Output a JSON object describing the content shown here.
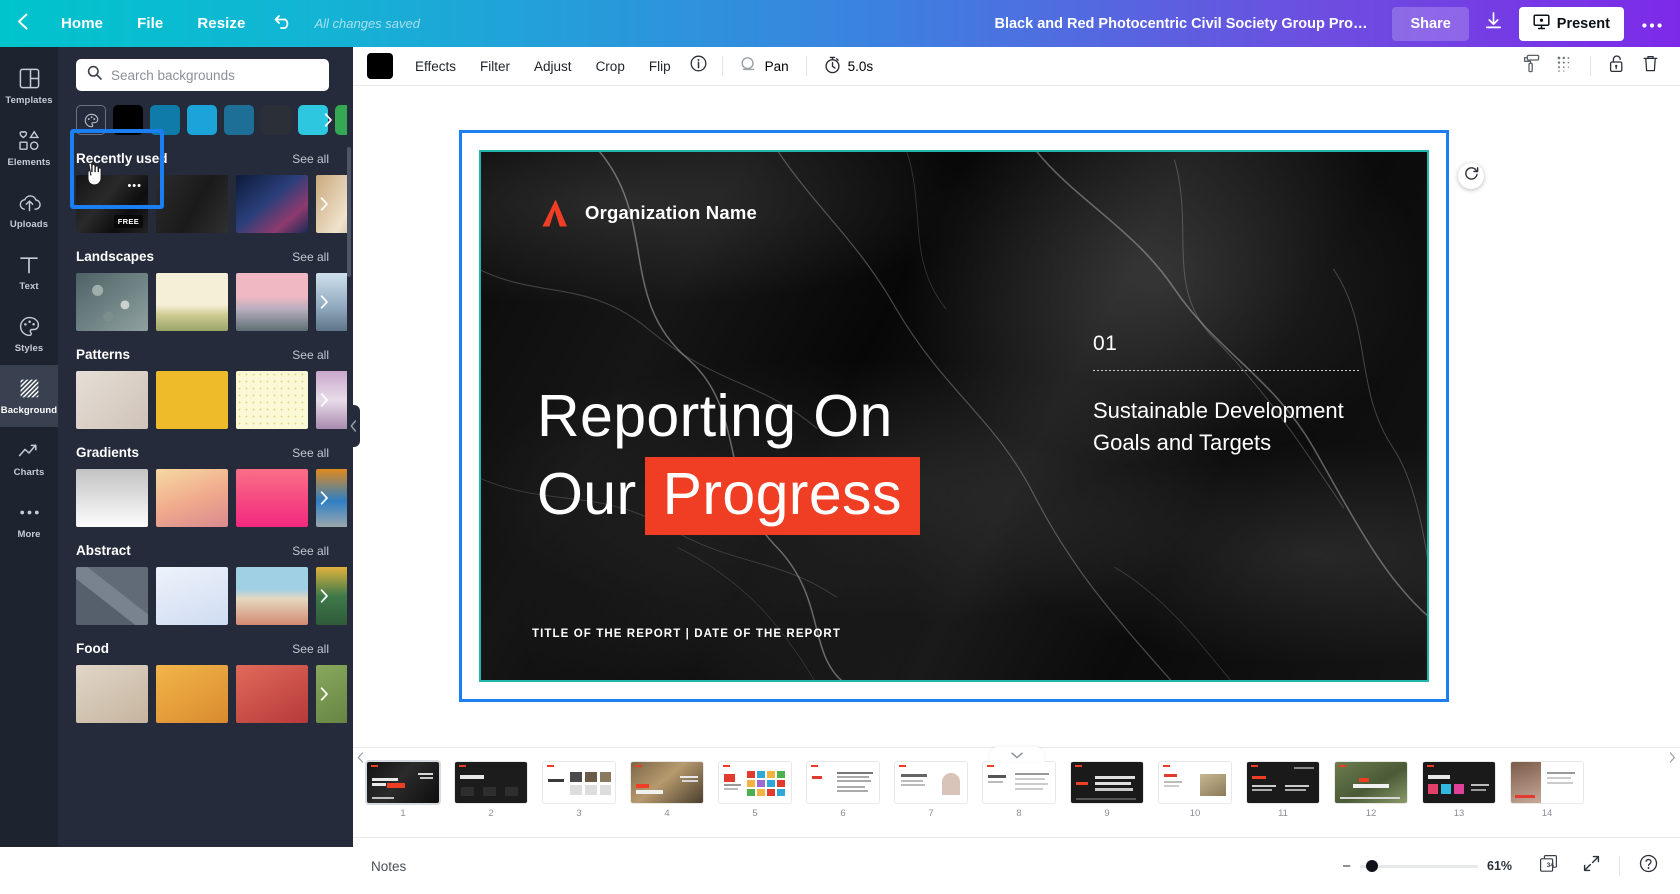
{
  "topbar": {
    "back_icon": "chevron-left-icon",
    "home": "Home",
    "file": "File",
    "resize": "Resize",
    "undo_icon": "undo-icon",
    "saved_status": "All changes saved",
    "design_title": "Black and Red Photocentric Civil Society Group Progress Re...",
    "share": "Share",
    "download_icon": "download-icon",
    "present": "Present",
    "present_icon": "present-icon",
    "more_icon": "more-horizontal-icon",
    "gradient_start": "#00c4cc",
    "gradient_end": "#7d2ae8"
  },
  "rail": {
    "items": [
      {
        "label": "Templates",
        "icon": "templates-icon",
        "active": false
      },
      {
        "label": "Elements",
        "icon": "elements-icon",
        "active": false
      },
      {
        "label": "Uploads",
        "icon": "uploads-icon",
        "active": false
      },
      {
        "label": "Text",
        "icon": "text-icon",
        "active": false
      },
      {
        "label": "Styles",
        "icon": "styles-icon",
        "active": false
      },
      {
        "label": "Background",
        "icon": "background-icon",
        "active": true
      },
      {
        "label": "Charts",
        "icon": "charts-icon",
        "active": false
      },
      {
        "label": "More",
        "icon": "more-icon",
        "active": false
      }
    ]
  },
  "panel": {
    "search_placeholder": "Search backgrounds",
    "search_value": "",
    "search_icon": "search-icon",
    "swatch_picker_icon": "color-wheel-icon",
    "swatches": [
      "#000000",
      "#0f7ba8",
      "#1ba3da",
      "#1d6f98",
      "#2b3038",
      "#2ec7e0",
      "#35a853"
    ],
    "see_all": "See all",
    "free_badge": "FREE",
    "sections": [
      {
        "title": "Recently used",
        "thumbs": [
          "#1c1c1c",
          "#2a2a2a",
          "#172a4d",
          "#b99a6d"
        ]
      },
      {
        "title": "Landscapes",
        "thumbs": [
          "#5d6b6e",
          "#efe7cf",
          "#d9aab2",
          "#8ba6bd"
        ]
      },
      {
        "title": "Patterns",
        "thumbs": [
          "#ded5cd",
          "#eebb2a",
          "#fbf6cc",
          "#b391b5"
        ]
      },
      {
        "title": "Gradients",
        "thumbs": [
          "#c9c9c9",
          "#f0b08a",
          "#f4567f",
          "#e08a1e"
        ]
      },
      {
        "title": "Abstract",
        "thumbs": [
          "#6e7681",
          "#dde7f5",
          "#e4b69a",
          "#3f7a4a"
        ]
      },
      {
        "title": "Food",
        "thumbs": [
          "#d8cfc4",
          "#e8a63a",
          "#d05050",
          "#6f8f4a"
        ]
      }
    ]
  },
  "toolbar": {
    "color_swatch": "#000000",
    "effects": "Effects",
    "filter": "Filter",
    "adjust": "Adjust",
    "crop": "Crop",
    "flip": "Flip",
    "info_icon": "info-icon",
    "pan": "Pan",
    "pan_icon": "pan-icon",
    "timer": "5.0s",
    "timer_icon": "timer-icon",
    "paint_icon": "paint-roller-icon",
    "transparency_icon": "transparency-icon",
    "lock_icon": "lock-open-icon",
    "delete_icon": "trash-icon"
  },
  "slide": {
    "organization": "Organization Name",
    "logo_icon": "org-logo-icon",
    "headline_line1": "Reporting On",
    "headline_line2_plain": "Our",
    "headline_line2_highlight": "Progress",
    "highlight_color": "#ef3e23",
    "section_number": "01",
    "section_title": "Sustainable Development Goals and Targets",
    "footer": "TITLE OF THE REPORT  |  DATE OF THE REPORT",
    "rotate_icon": "rotate-icon",
    "selection_color": "#1c7ef3",
    "border_color": "#1fb6ad"
  },
  "strip": {
    "pages": [
      {
        "num": "1",
        "bg": "#1a1a1a",
        "active": true
      },
      {
        "num": "2",
        "bg": "#1f1f1f",
        "active": false
      },
      {
        "num": "3",
        "bg": "#ffffff",
        "active": false
      },
      {
        "num": "4",
        "bg": "#6a5a45",
        "active": false
      },
      {
        "num": "5",
        "bg": "#ffffff",
        "active": false
      },
      {
        "num": "6",
        "bg": "#ffffff",
        "active": false
      },
      {
        "num": "7",
        "bg": "#ffffff",
        "active": false
      },
      {
        "num": "8",
        "bg": "#ffffff",
        "active": false
      },
      {
        "num": "9",
        "bg": "#1a1a1a",
        "active": false
      },
      {
        "num": "10",
        "bg": "#ffffff",
        "active": false
      },
      {
        "num": "11",
        "bg": "#1a1a1a",
        "active": false
      },
      {
        "num": "12",
        "bg": "#5d6b45",
        "active": false
      },
      {
        "num": "13",
        "bg": "#1a1a1a",
        "active": false
      },
      {
        "num": "14",
        "bg": "#ffffff",
        "active": false
      }
    ],
    "toggle_icon": "chevron-down-icon",
    "scroll_left_icon": "chevron-left-icon",
    "scroll_right_icon": "chevron-right-icon"
  },
  "bottombar": {
    "notes": "Notes",
    "zoom_percent": "61%",
    "zoom_minus": "−",
    "page_count": "34",
    "pages_icon": "page-count-icon",
    "fullscreen_icon": "expand-icon",
    "help_icon": "help-icon"
  }
}
